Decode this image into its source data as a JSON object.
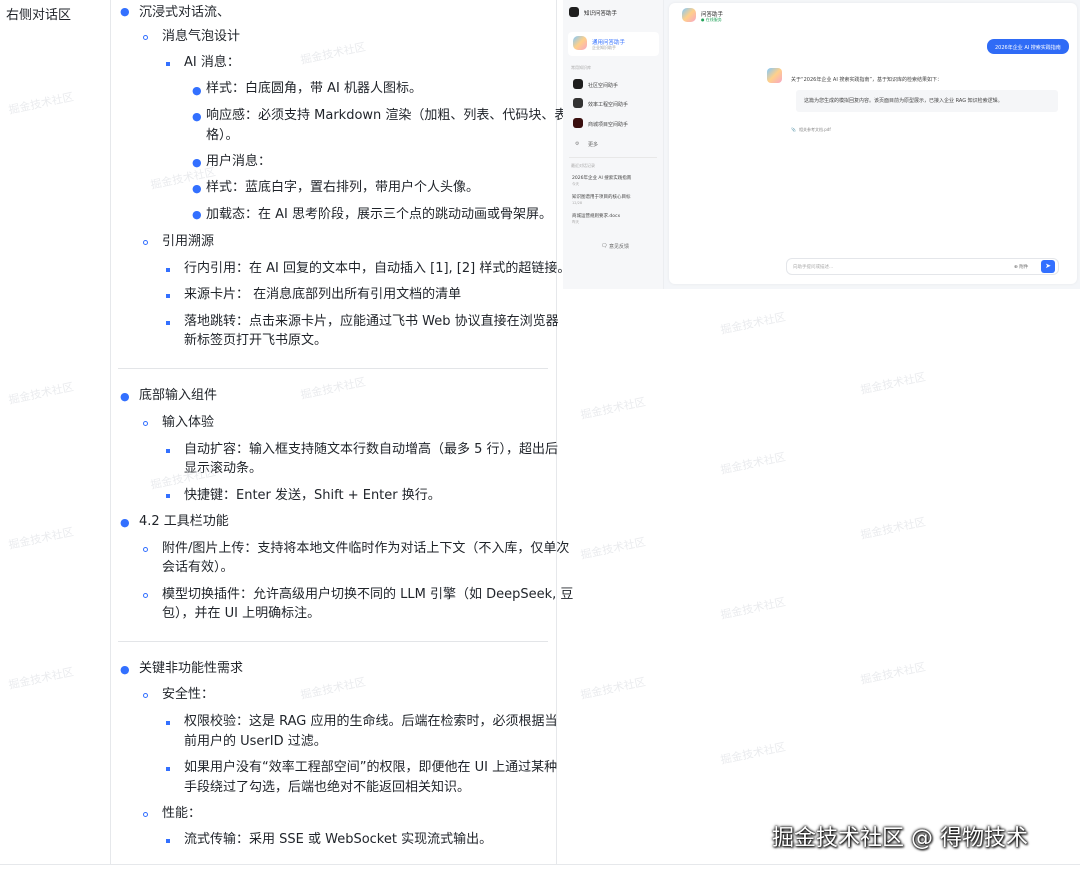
{
  "label_column": "右侧对话区",
  "content": {
    "l1": "沉浸式对话流、",
    "l2": "消息气泡设计",
    "l3": "AI 消息：",
    "l4": "样式：白底圆角，带 AI 机器人图标。",
    "l5a": "响应感：必须支持 Markdown 渲染（加粗、列表、代码块、表",
    "l5b": "格）。",
    "l6": "用户消息：",
    "l7": "样式：蓝底白字，置右排列，带用户个人头像。",
    "l8": "加载态：在 AI 思考阶段，展示三个点的跳动动画或骨架屏。",
    "l9": "引用溯源",
    "l10": "行内引用：在 AI 回复的文本中，自动插入 [1], [2] 样式的超链接。",
    "l11": "来源卡片： 在消息底部列出所有引用文档的清单",
    "l12a": "落地跳转：点击来源卡片，应能通过飞书 Web 协议直接在浏览器",
    "l12b": "新标签页打开飞书原文。",
    "l13": "底部输入组件",
    "l14": "输入体验",
    "l15a": "自动扩容：输入框支持随文本行数自动增高（最多 5 行），超出后",
    "l15b": "显示滚动条。",
    "l16": "快捷键：Enter 发送，Shift + Enter 换行。",
    "l17": "4.2 工具栏功能",
    "l18a": "附件/图片上传：支持将本地文件临时作为对话上下文（不入库，仅单次",
    "l18b": "会话有效）。",
    "l19a": "模型切换插件：允许高级用户切换不同的 LLM 引擎（如 DeepSeek, 豆",
    "l19b": "包），并在 UI 上明确标注。",
    "l20": "关键非功能性需求",
    "l21": "安全性：",
    "l22a": "权限校验：这是 RAG 应用的生命线。后端在检索时，必须根据当",
    "l22b": "前用户的 UserID 过滤。",
    "l23a": "如果用户没有“效率工程部空间”的权限，即便他在 UI 上通过某种",
    "l23b": "手段绕过了勾选，后端也绝对不能返回相关知识。",
    "l24": "性能：",
    "l25": "流式传输：采用 SSE 或 WebSocket 实现流式输出。"
  },
  "mockup": {
    "app_title": "知识问答助手",
    "active_assistant": "通用问答助手",
    "active_assistant_sub": "企业知识助手",
    "section_label": "常用知识库",
    "kb_items": [
      "社区空间助手",
      "效率工程空间助手",
      "商城项目空间助手"
    ],
    "more": "更多",
    "history_label": "最近对话记录",
    "history": [
      {
        "title": "2026年企业 AI 搜索实践指南",
        "time": "今天"
      },
      {
        "title": "知识图谱用于项目的核心目标",
        "time": "12/28"
      },
      {
        "title": "商城运营规则要求.docx",
        "time": "昨天"
      }
    ],
    "feedback": "意见反馈",
    "chat_title": "问答助手",
    "chat_status": "● 在线服务",
    "user_msg": "2026年企业 AI 搜索实践指南",
    "ai_intro": "关于“2026年企业 AI 搜索实践指南”，基于知识库的检索结果如下：",
    "ai_quote": "这篇为您生成的模拟回复内容。该页面目前为原型展示，已接入企业 RAG 知识检索逻辑。",
    "attachment": "相关参考文档.pdf",
    "input_placeholder": "向助手提问或描述...",
    "input_tool": "⊕ 附件",
    "send_icon": "send-icon"
  },
  "watermark_text": "掘金技术社区",
  "footer": "掘金技术社区 @ 得物技术",
  "colors": {
    "accent": "#3370ff",
    "user_bubble": "#2f6bf6"
  }
}
